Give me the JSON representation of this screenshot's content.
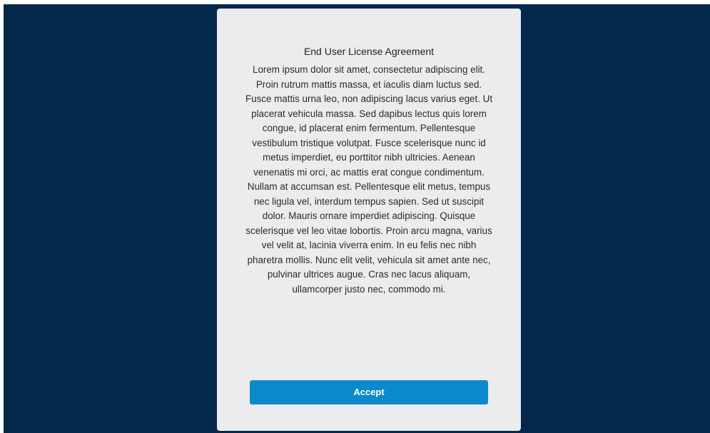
{
  "dialog": {
    "title": "End User License Agreement",
    "body": "Lorem ipsum dolor sit amet, consectetur adipiscing elit. Proin rutrum mattis massa, et iaculis diam luctus sed. Fusce mattis urna leo, non adipiscing lacus varius eget. Ut placerat vehicula massa. Sed dapibus lectus quis lorem congue, id placerat enim fermentum. Pellentesque vestibulum tristique volutpat. Fusce scelerisque nunc id metus imperdiet, eu porttitor nibh ultricies. Aenean venenatis mi orci, ac mattis erat congue condimentum. Nullam at accumsan est. Pellentesque elit metus, tempus nec ligula vel, interdum tempus sapien. Sed ut suscipit dolor. Mauris ornare imperdiet adipiscing. Quisque scelerisque vel leo vitae lobortis. Proin arcu magna, varius vel velit at, lacinia viverra enim. In eu felis nec nibh pharetra mollis. Nunc elit velit, vehicula sit amet ante nec, pulvinar ultrices augue. Cras nec lacus aliquam, ullamcorper justo nec, commodo mi.",
    "accept_label": "Accept"
  },
  "colors": {
    "backdrop": "#04284a",
    "dialog_background": "#ececee",
    "accent": "#0b8acb"
  }
}
